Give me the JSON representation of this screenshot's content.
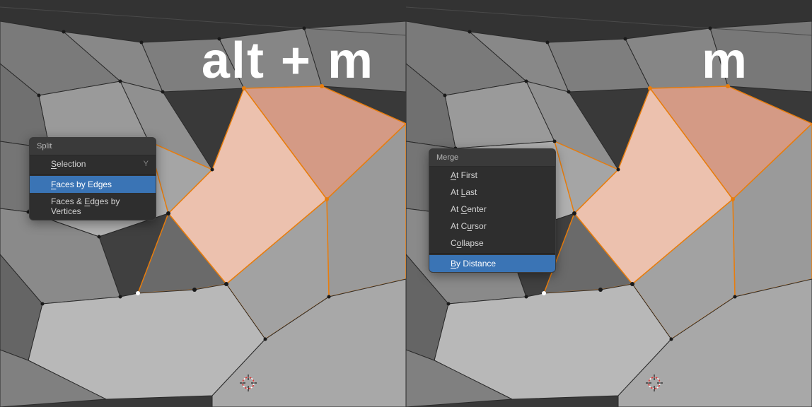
{
  "left_panel": {
    "shortcut_text": "alt + m",
    "menu": {
      "title": "Split",
      "items": [
        {
          "label": "Selection",
          "shortcut": "Y",
          "highlighted": false,
          "underline_char": "S"
        },
        {
          "label": "Faces by Edges",
          "shortcut": "",
          "highlighted": true,
          "underline_char": "F"
        },
        {
          "label": "Faces & Edges by Vertices",
          "shortcut": "",
          "highlighted": false,
          "underline_char": "E"
        }
      ]
    }
  },
  "right_panel": {
    "shortcut_text": "m",
    "menu": {
      "title": "Merge",
      "items": [
        {
          "label": "At First",
          "shortcut": "",
          "highlighted": false,
          "underline_char": "A"
        },
        {
          "label": "At Last",
          "shortcut": "",
          "highlighted": false,
          "underline_char": "L"
        },
        {
          "label": "At Center",
          "shortcut": "",
          "highlighted": false,
          "underline_char": "C"
        },
        {
          "label": "At Cursor",
          "shortcut": "",
          "highlighted": false,
          "underline_char": "u"
        },
        {
          "label": "Collapse",
          "shortcut": "",
          "highlighted": false,
          "underline_char": "o"
        },
        {
          "label": "By Distance",
          "shortcut": "",
          "highlighted": true,
          "underline_char": "B"
        }
      ]
    }
  },
  "colors": {
    "selected_face": "#e8b4a0",
    "selected_face_dark": "#d49a85",
    "edge_orange": "#e87d0d",
    "mesh_grey_1": "#9a9a9a",
    "mesh_grey_2": "#808080",
    "mesh_grey_3": "#6a6a6a",
    "mesh_grey_4": "#555555",
    "mesh_grey_5": "#bbbbbb",
    "bg_dark": "#393939",
    "highlight_blue": "#3a74b5"
  }
}
